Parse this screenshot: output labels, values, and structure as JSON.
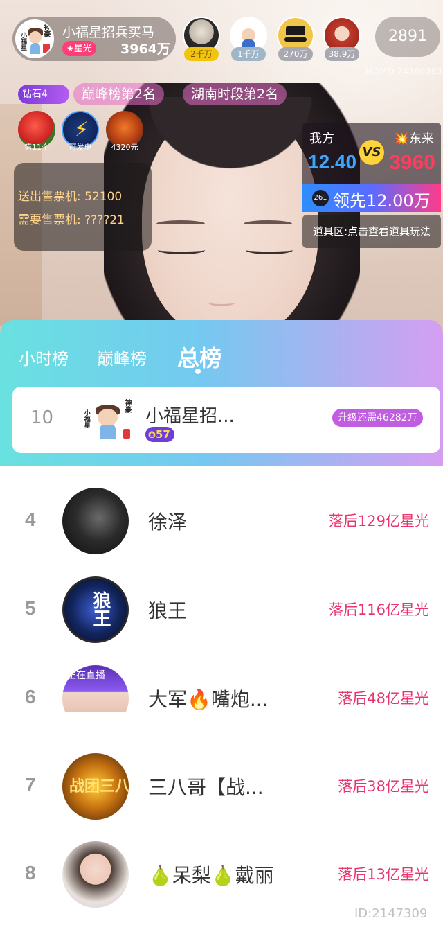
{
  "host": {
    "name": "小福星招兵买马",
    "badge": "星光",
    "stars": "3964万",
    "avatar_tag_left": "小福星",
    "avatar_tag_right": "神豪"
  },
  "viewers": [
    {
      "tag": "2千万"
    },
    {
      "tag": "1千万"
    },
    {
      "tag": "270万"
    },
    {
      "tag": "38.9万"
    }
  ],
  "online_count": "2891",
  "watermark_top": "MOMO 74360363",
  "badges": {
    "diamond": "钻石4",
    "rank1": "巅峰榜第2名",
    "rank2": "湖南时段第2名"
  },
  "gifts": [
    {
      "label": "第11个",
      "icon": "fruit-icon"
    },
    {
      "label": "可发电",
      "icon": "lightning-icon"
    },
    {
      "label": "4320元",
      "icon": "helmet-icon"
    }
  ],
  "tickets": {
    "sent": "送出售票机: 52100",
    "need": "需要售票机: ????21"
  },
  "pk": {
    "us_label": "我方",
    "them_label": "东来",
    "us_score": "12.40",
    "them_score": "3960",
    "vs": "VS",
    "lead_badge": "261",
    "lead_text": "领先12.00万",
    "prop_text": "道具区:点击查看道具玩法"
  },
  "tabs": [
    "小时榜",
    "巅峰榜",
    "总榜"
  ],
  "active_tab": "总榜",
  "my_entry": {
    "rank": "10",
    "name": "小福星招...",
    "level": "57",
    "upgrade": "升级还需46282万"
  },
  "ranking": [
    {
      "rank": "4",
      "name": "徐泽",
      "gap": "落后129亿星光"
    },
    {
      "rank": "5",
      "name": "狼王",
      "gap": "落后116亿星光",
      "avatar_text": "狼王"
    },
    {
      "rank": "6",
      "name": "大军🔥嘴炮...",
      "gap": "落后48亿星光",
      "avatar_text": "正在直播"
    },
    {
      "rank": "7",
      "name": "三八哥【战...",
      "gap": "落后38亿星光",
      "avatar_text": "战团三八"
    },
    {
      "rank": "8",
      "name": "🍐呆梨🍐戴丽",
      "gap": "落后13亿星光"
    }
  ],
  "watermark_bottom": "ID:2147309"
}
